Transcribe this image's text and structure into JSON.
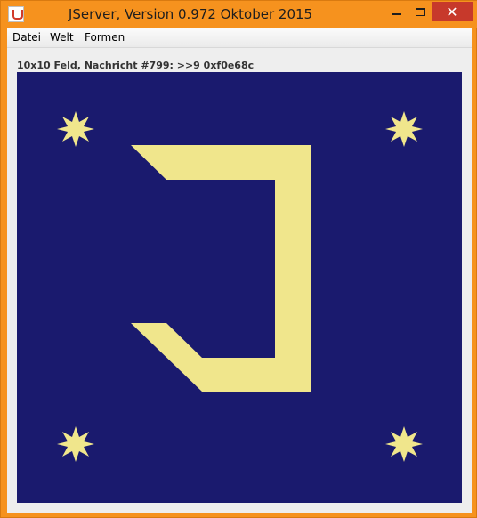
{
  "window": {
    "title": "JServer, Version 0.972 Oktober 2015",
    "close_glyph": "✕",
    "frame_color": "#f6921e",
    "close_color": "#c7392b"
  },
  "menubar": {
    "items": [
      {
        "label": "Datei"
      },
      {
        "label": "Welt"
      },
      {
        "label": "Formen"
      }
    ]
  },
  "status_text": "10x10 Feld, Nachricht #799: >>9 0xf0e68c",
  "canvas": {
    "background_color": "#1a1a6e",
    "shape_color": "#f0e68c",
    "shapes": [
      {
        "kind": "star",
        "icon": "star-icon"
      },
      {
        "kind": "star",
        "icon": "star-icon"
      },
      {
        "kind": "star",
        "icon": "star-icon"
      },
      {
        "kind": "star",
        "icon": "star-icon"
      },
      {
        "kind": "letter",
        "name": "J"
      }
    ]
  }
}
